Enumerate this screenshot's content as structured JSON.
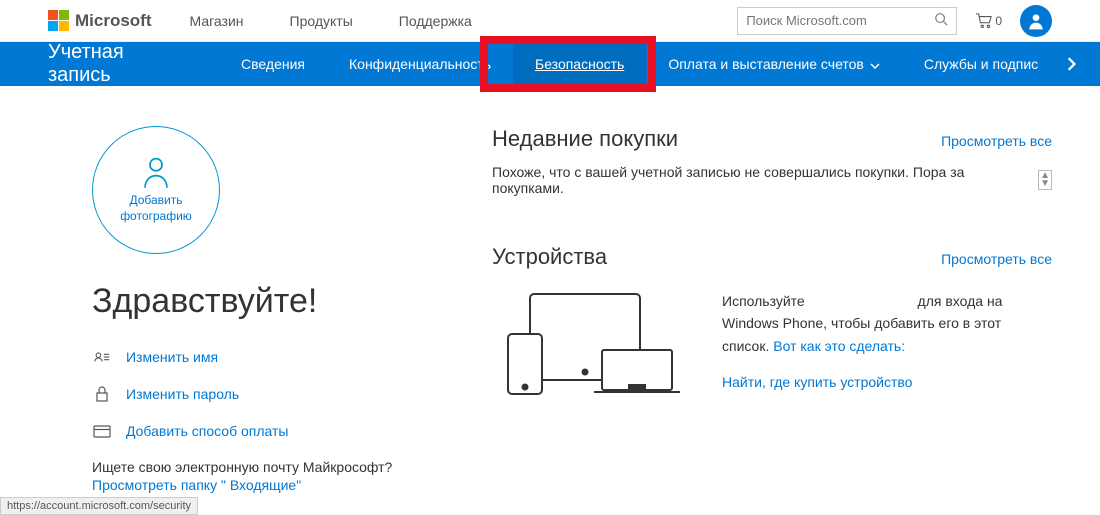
{
  "header": {
    "brand": "Microsoft",
    "nav": [
      "Магазин",
      "Продукты",
      "Поддержка"
    ],
    "search_placeholder": "Поиск Microsoft.com",
    "cart_count": "0"
  },
  "bluebar": {
    "title": "Учетная запись",
    "items": [
      {
        "label": "Сведения"
      },
      {
        "label": "Конфиденциальность"
      },
      {
        "label": "Безопасность",
        "active": true
      },
      {
        "label": "Оплата и выставление счетов",
        "dropdown": true
      },
      {
        "label": "Службы и подпис"
      }
    ]
  },
  "profile": {
    "add_photo_line1": "Добавить",
    "add_photo_line2": "фотографию",
    "greeting": "Здравствуйте!",
    "actions": {
      "edit_name": "Изменить имя",
      "change_password": "Изменить пароль",
      "add_payment": "Добавить способ оплаты"
    },
    "email_question": "Ищете свою электронную почту Майкрософт?",
    "email_inbox_link": "Просмотреть папку \" Входящие\""
  },
  "purchases": {
    "title": "Недавние покупки",
    "view_all": "Просмотреть все",
    "empty_text": "Похоже, что с вашей учетной записью не совершались покупки. Пора за покупками."
  },
  "devices": {
    "title": "Устройства",
    "view_all": "Просмотреть все",
    "text_prefix": "Используйте",
    "text_suffix": "для входа на Windows Phone, чтобы добавить его в этот список.",
    "howto_link": "Вот как это сделать:",
    "find_link": "Найти, где купить устройство"
  },
  "status_url": "https://account.microsoft.com/security"
}
